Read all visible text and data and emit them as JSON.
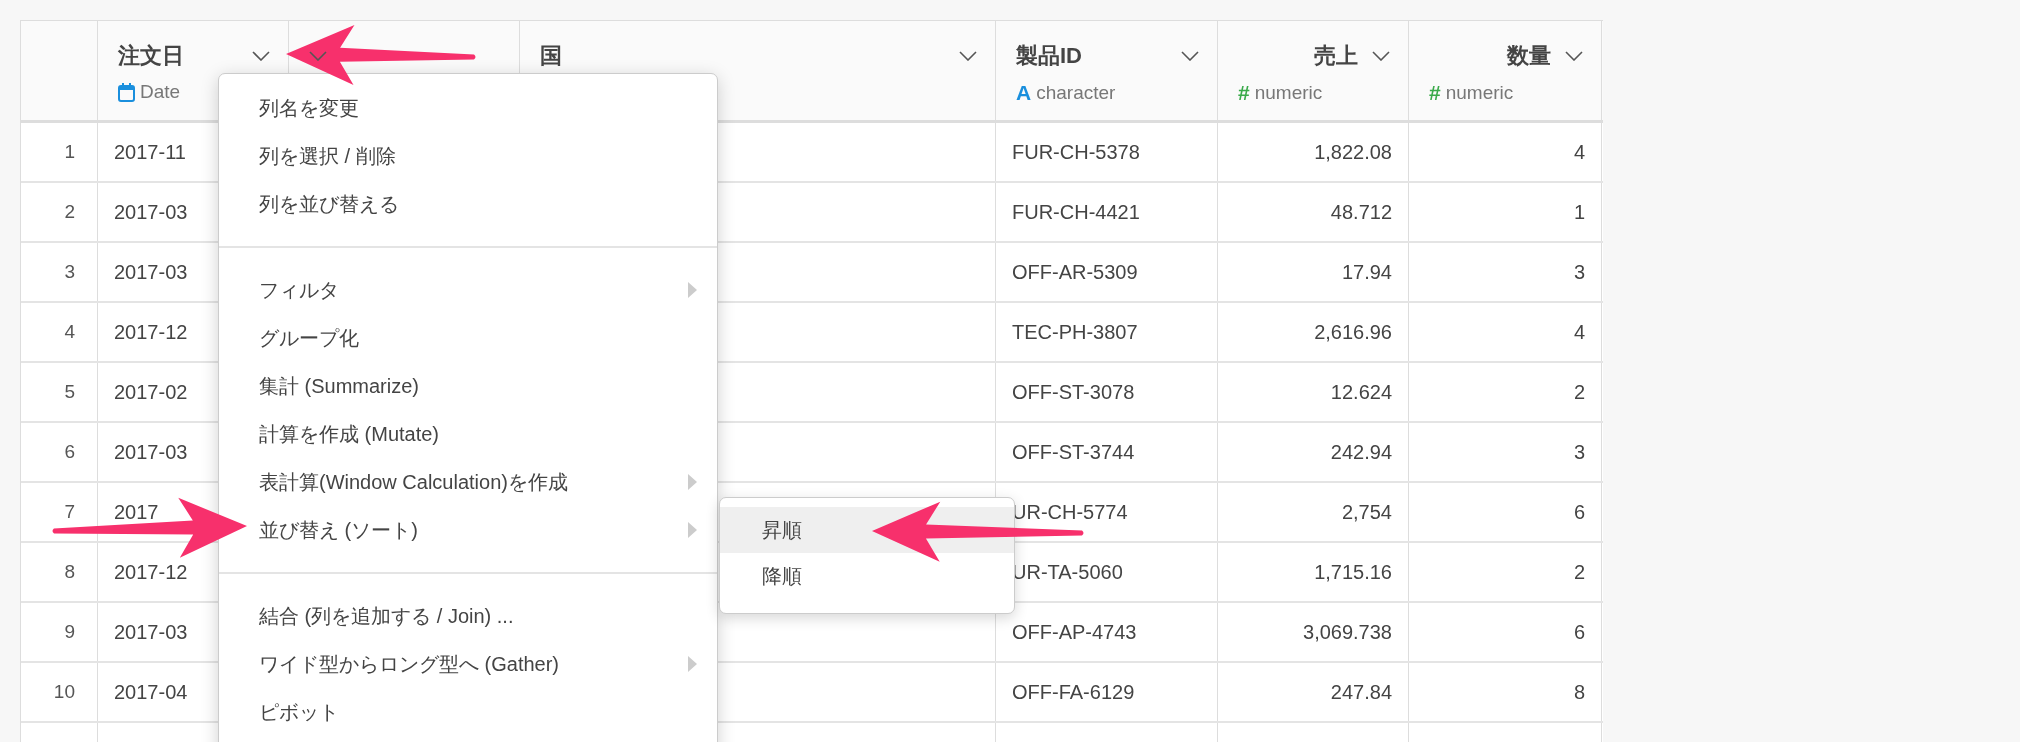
{
  "table": {
    "columns": [
      {
        "name": "注文日",
        "type": "Date",
        "kind": "date",
        "menu_button": true
      },
      {
        "kind": "hidden",
        "menu_button": true
      },
      {
        "name": "国",
        "kind": "plain",
        "menu_button": true
      },
      {
        "name": "製品ID",
        "type": "character",
        "type_mark": "A",
        "kind": "character",
        "menu_button": true
      },
      {
        "name": "売上",
        "type": "numeric",
        "type_mark": "#",
        "kind": "numeric",
        "menu_button": true
      },
      {
        "name": "数量",
        "type": "numeric",
        "type_mark": "#",
        "kind": "numeric",
        "menu_button": true
      }
    ],
    "rows": [
      {
        "number": "1",
        "order_date": "2017-11",
        "product_id": "FUR-CH-5378",
        "sales": "1,822.08",
        "quantity": "4"
      },
      {
        "number": "2",
        "order_date": "2017-03",
        "product_id": "FUR-CH-4421",
        "sales": "48.712",
        "quantity": "1"
      },
      {
        "number": "3",
        "order_date": "2017-03",
        "product_id": "OFF-AR-5309",
        "sales": "17.94",
        "quantity": "3"
      },
      {
        "number": "4",
        "order_date": "2017-12",
        "product_id": "TEC-PH-3807",
        "sales": "2,616.96",
        "quantity": "4"
      },
      {
        "number": "5",
        "order_date": "2017-02",
        "product_id": "OFF-ST-3078",
        "sales": "12.624",
        "quantity": "2"
      },
      {
        "number": "6",
        "order_date": "2017-03",
        "product_id": "OFF-ST-3744",
        "sales": "242.94",
        "quantity": "3"
      },
      {
        "number": "7",
        "order_date": "2017",
        "product_id": "UR-CH-5774",
        "sales": "2,754",
        "quantity": "6"
      },
      {
        "number": "8",
        "order_date": "2017-12",
        "product_id": "UR-TA-5060",
        "sales": "1,715.16",
        "quantity": "2"
      },
      {
        "number": "9",
        "order_date": "2017-03",
        "product_id": "OFF-AP-4743",
        "sales": "3,069.738",
        "quantity": "6"
      },
      {
        "number": "10",
        "order_date": "2017-04",
        "product_id": "OFF-FA-6129",
        "sales": "247.84",
        "quantity": "8"
      }
    ]
  },
  "column_menu": {
    "items": [
      {
        "kind": "item",
        "label": "列名を変更",
        "has_submenu": false
      },
      {
        "kind": "item",
        "label": "列を選択 / 削除",
        "has_submenu": false
      },
      {
        "kind": "item",
        "label": "列を並び替える",
        "has_submenu": false
      },
      {
        "kind": "divider"
      },
      {
        "kind": "item",
        "label": "フィルタ",
        "has_submenu": true
      },
      {
        "kind": "item",
        "label": "グループ化",
        "has_submenu": false
      },
      {
        "kind": "item",
        "label": "集計 (Summarize)",
        "has_submenu": false
      },
      {
        "kind": "item",
        "label": "計算を作成 (Mutate)",
        "has_submenu": false
      },
      {
        "kind": "item",
        "label": "表計算(Window Calculation)を作成",
        "has_submenu": true
      },
      {
        "kind": "item",
        "label": "並び替え (ソート)",
        "has_submenu": true
      },
      {
        "kind": "divider"
      },
      {
        "kind": "item",
        "label": "結合 (列を追加する / Join) ...",
        "has_submenu": false
      },
      {
        "kind": "item",
        "label": "ワイド型からロング型へ (Gather)",
        "has_submenu": true
      },
      {
        "kind": "item",
        "label": "ピボット",
        "has_submenu": false
      }
    ]
  },
  "sort_submenu": {
    "items": [
      {
        "label": "昇順",
        "selected": true
      },
      {
        "label": "降順",
        "selected": false
      }
    ]
  }
}
